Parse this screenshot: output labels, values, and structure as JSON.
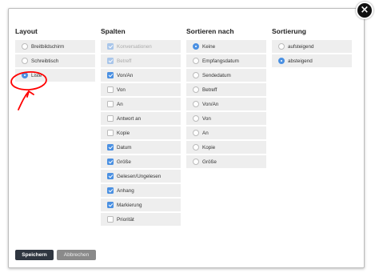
{
  "dialog": {
    "close_glyph": "×",
    "close_icon": "close-icon"
  },
  "columns": {
    "layout": {
      "title": "Layout",
      "options": [
        {
          "label": "Breitbildschirm",
          "selected": false
        },
        {
          "label": "Schreibtisch",
          "selected": false
        },
        {
          "label": "Liste",
          "selected": true
        }
      ]
    },
    "spalten": {
      "title": "Spalten",
      "options": [
        {
          "label": "Konversationen",
          "checked": true,
          "disabled": true
        },
        {
          "label": "Betreff",
          "checked": true,
          "disabled": true
        },
        {
          "label": "Von/An",
          "checked": true,
          "disabled": false
        },
        {
          "label": "Von",
          "checked": false,
          "disabled": false
        },
        {
          "label": "An",
          "checked": false,
          "disabled": false
        },
        {
          "label": "Antwort an",
          "checked": false,
          "disabled": false
        },
        {
          "label": "Kopie",
          "checked": false,
          "disabled": false
        },
        {
          "label": "Datum",
          "checked": true,
          "disabled": false
        },
        {
          "label": "Größe",
          "checked": true,
          "disabled": false
        },
        {
          "label": "Gelesen/Ungelesen",
          "checked": true,
          "disabled": false
        },
        {
          "label": "Anhang",
          "checked": true,
          "disabled": false
        },
        {
          "label": "Markierung",
          "checked": true,
          "disabled": false
        },
        {
          "label": "Priorität",
          "checked": false,
          "disabled": false
        }
      ]
    },
    "sortieren": {
      "title": "Sortieren nach",
      "options": [
        {
          "label": "Keine",
          "selected": true
        },
        {
          "label": "Empfangsdatum",
          "selected": false
        },
        {
          "label": "Sendedatum",
          "selected": false
        },
        {
          "label": "Betreff",
          "selected": false
        },
        {
          "label": "Von/An",
          "selected": false
        },
        {
          "label": "Von",
          "selected": false
        },
        {
          "label": "An",
          "selected": false
        },
        {
          "label": "Kopie",
          "selected": false
        },
        {
          "label": "Größe",
          "selected": false
        }
      ]
    },
    "sortierung": {
      "title": "Sortierung",
      "options": [
        {
          "label": "aufsteigend",
          "selected": false
        },
        {
          "label": "absteigend",
          "selected": true
        }
      ]
    }
  },
  "footer": {
    "save_label": "Speichern",
    "cancel_label": "Abbrechen"
  },
  "colors": {
    "accent": "#4a90e2",
    "annotation": "#ff0000"
  }
}
